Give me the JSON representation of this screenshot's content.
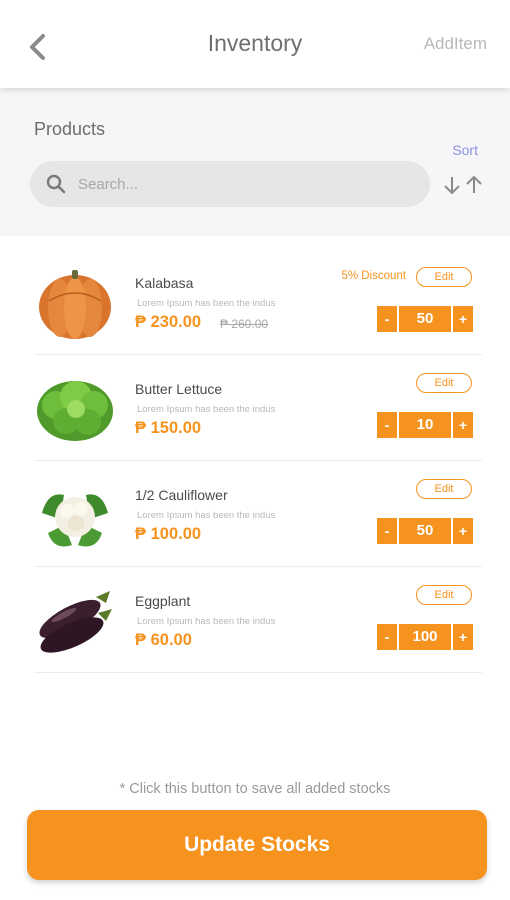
{
  "header": {
    "title": "Inventory",
    "add_item_label": "AddItem"
  },
  "products_panel": {
    "title": "Products",
    "sort_label": "Sort",
    "search": {
      "placeholder": "Search...",
      "value": ""
    }
  },
  "items": [
    {
      "name": "Kalabasa",
      "description": "Lorem Ipsum has been the indus",
      "price": "₱ 230.00",
      "old_price": "₱ 260.00",
      "discount": "5% Discount",
      "edit_label": "Edit",
      "quantity": "50",
      "minus": "-",
      "plus": "+"
    },
    {
      "name": "Butter Lettuce",
      "description": "Lorem Ipsum has been the indus",
      "price": "₱ 150.00",
      "edit_label": "Edit",
      "quantity": "10",
      "minus": "-",
      "plus": "+"
    },
    {
      "name": "1/2 Cauliflower",
      "description": "Lorem Ipsum has been the indus",
      "price": "₱ 100.00",
      "edit_label": "Edit",
      "quantity": "50",
      "minus": "-",
      "plus": "+"
    },
    {
      "name": "Eggplant",
      "description": "Lorem Ipsum has been the indus",
      "price": "₱ 60.00",
      "edit_label": "Edit",
      "quantity": "100",
      "minus": "-",
      "plus": "+"
    }
  ],
  "footer": {
    "hint": "* Click this button to save all added stocks",
    "update_label": "Update Stocks"
  },
  "colors": {
    "accent": "#f6921e",
    "sort": "#8c8fe0",
    "panel_bg": "#f6f6f8"
  }
}
